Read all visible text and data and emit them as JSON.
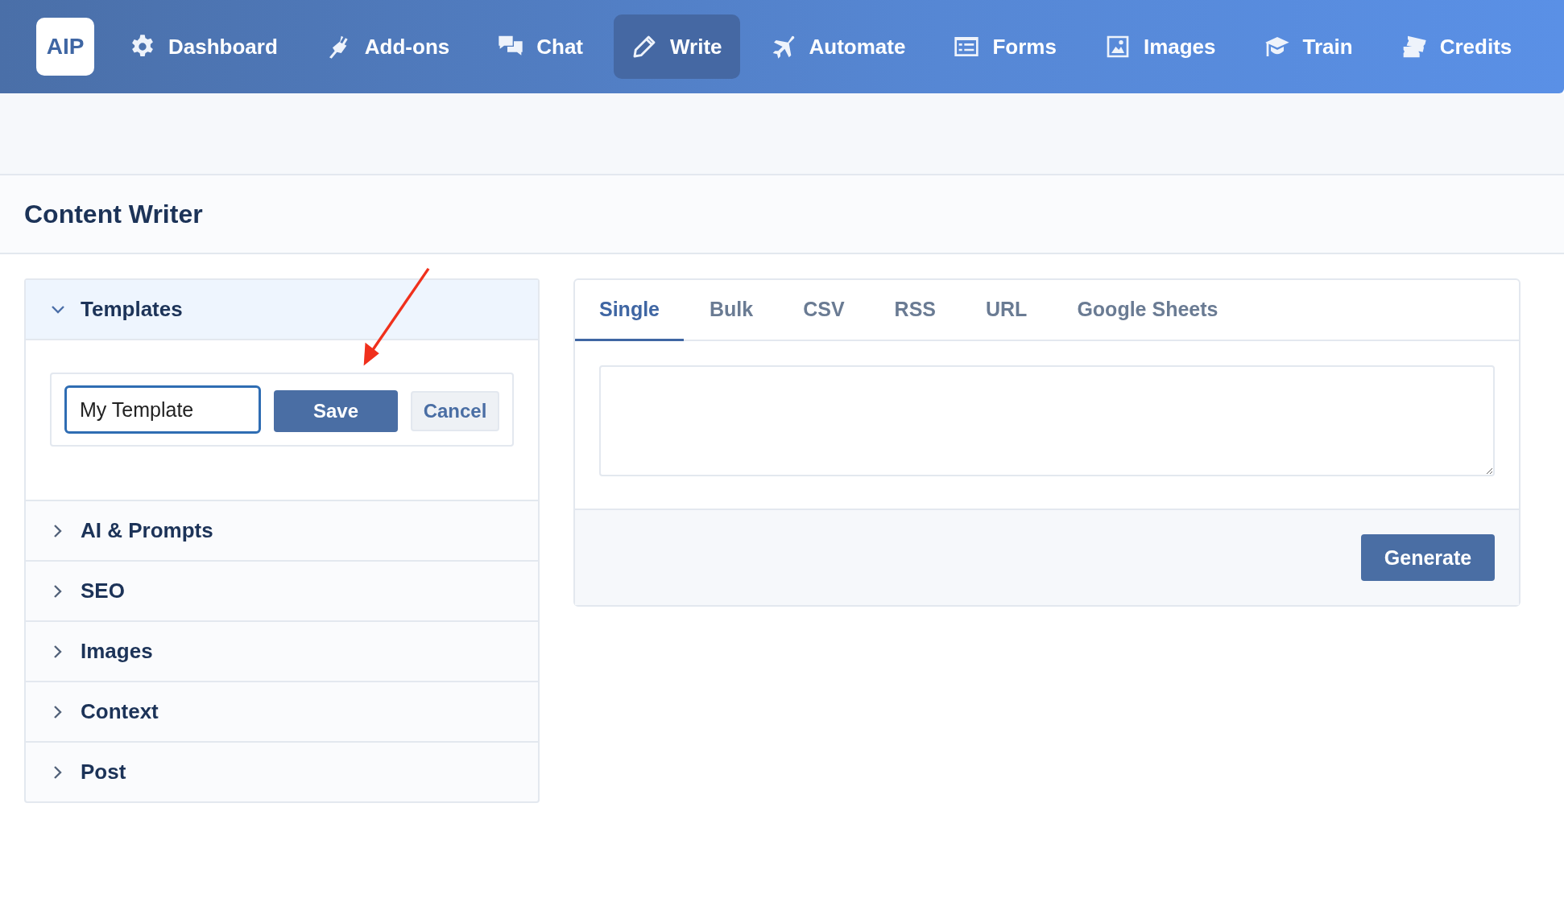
{
  "nav": {
    "logo": "AIP",
    "items": [
      {
        "label": "Dashboard",
        "selected": false
      },
      {
        "label": "Add-ons",
        "selected": false
      },
      {
        "label": "Chat",
        "selected": false
      },
      {
        "label": "Write",
        "selected": true
      },
      {
        "label": "Automate",
        "selected": false
      },
      {
        "label": "Forms",
        "selected": false
      },
      {
        "label": "Images",
        "selected": false
      },
      {
        "label": "Train",
        "selected": false
      },
      {
        "label": "Credits",
        "selected": false
      }
    ]
  },
  "page": {
    "title": "Content Writer"
  },
  "sections": [
    {
      "label": "Templates",
      "expanded": true,
      "template_form": {
        "name_value": "My Template",
        "save": "Save",
        "cancel": "Cancel"
      }
    },
    {
      "label": "AI & Prompts",
      "expanded": false
    },
    {
      "label": "SEO",
      "expanded": false
    },
    {
      "label": "Images",
      "expanded": false
    },
    {
      "label": "Context",
      "expanded": false
    },
    {
      "label": "Post",
      "expanded": false
    }
  ],
  "writer": {
    "tabs": [
      {
        "label": "Single",
        "selected": true
      },
      {
        "label": "Bulk",
        "selected": false
      },
      {
        "label": "CSV",
        "selected": false
      },
      {
        "label": "RSS",
        "selected": false
      },
      {
        "label": "URL",
        "selected": false
      },
      {
        "label": "Google Sheets",
        "selected": false
      }
    ],
    "generate": "Generate"
  },
  "annotation": {
    "kind": "arrow"
  }
}
